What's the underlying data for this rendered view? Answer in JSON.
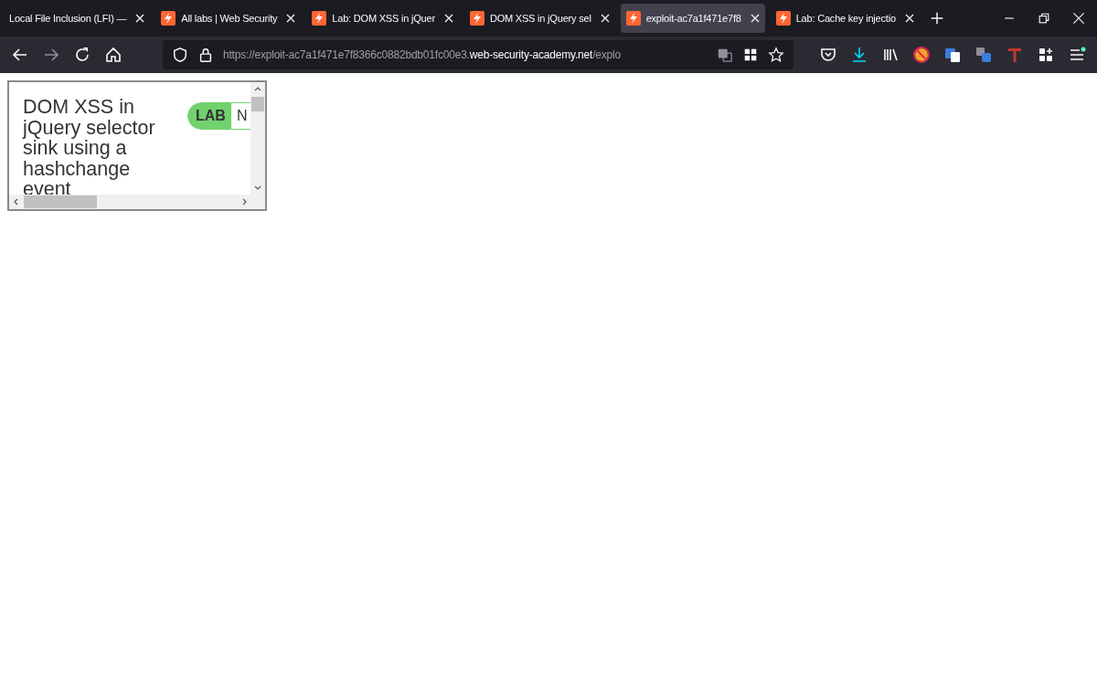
{
  "tabs": [
    {
      "title": "Local File Inclusion (LFI) —",
      "favicon": false,
      "selected": false
    },
    {
      "title": "All labs | Web Security",
      "favicon": true,
      "selected": false
    },
    {
      "title": "Lab: DOM XSS in jQuer",
      "favicon": true,
      "selected": false
    },
    {
      "title": "DOM XSS in jQuery sel",
      "favicon": true,
      "selected": false
    },
    {
      "title": "exploit-ac7a1f471e7f8",
      "favicon": true,
      "selected": true
    },
    {
      "title": "Lab: Cache key injectio",
      "favicon": true,
      "selected": false
    }
  ],
  "address_bar": {
    "scheme_host_prefix": "https://exploit-ac7a1f471e7f8366c0882bdb01fc00e3.",
    "domain": "web-security-academy.net",
    "path": "/explo"
  },
  "frame": {
    "title": "DOM XSS in jQuery selector sink using a hashchange event",
    "badge": "LAB",
    "status": "N"
  }
}
